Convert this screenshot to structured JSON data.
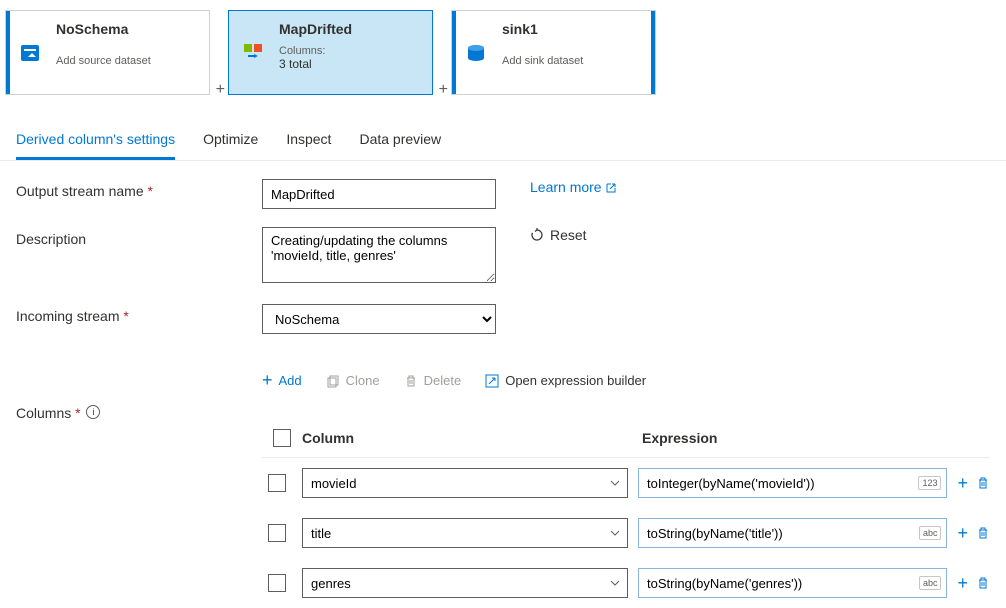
{
  "nodes": {
    "source": {
      "title": "NoSchema",
      "sub": "Add source dataset"
    },
    "derived": {
      "title": "MapDrifted",
      "sub1": "Columns:",
      "sub2": "3 total"
    },
    "sink": {
      "title": "sink1",
      "sub": "Add sink dataset"
    }
  },
  "tabs": {
    "settings": "Derived column's settings",
    "optimize": "Optimize",
    "inspect": "Inspect",
    "preview": "Data preview"
  },
  "form": {
    "output_label": "Output stream name",
    "output_value": "MapDrifted",
    "desc_label": "Description",
    "desc_value": "Creating/updating the columns 'movieId, title, genres'",
    "incoming_label": "Incoming stream",
    "incoming_value": "NoSchema",
    "learn_more": "Learn more",
    "reset": "Reset",
    "columns_label": "Columns"
  },
  "toolbar": {
    "add": "Add",
    "clone": "Clone",
    "delete": "Delete",
    "builder": "Open expression builder"
  },
  "table": {
    "header_col": "Column",
    "header_expr": "Expression",
    "rows": [
      {
        "name": "movieId",
        "expr": "toInteger(byName('movieId'))",
        "type": "123"
      },
      {
        "name": "title",
        "expr": "toString(byName('title'))",
        "type": "abc"
      },
      {
        "name": "genres",
        "expr": "toString(byName('genres'))",
        "type": "abc"
      }
    ]
  }
}
